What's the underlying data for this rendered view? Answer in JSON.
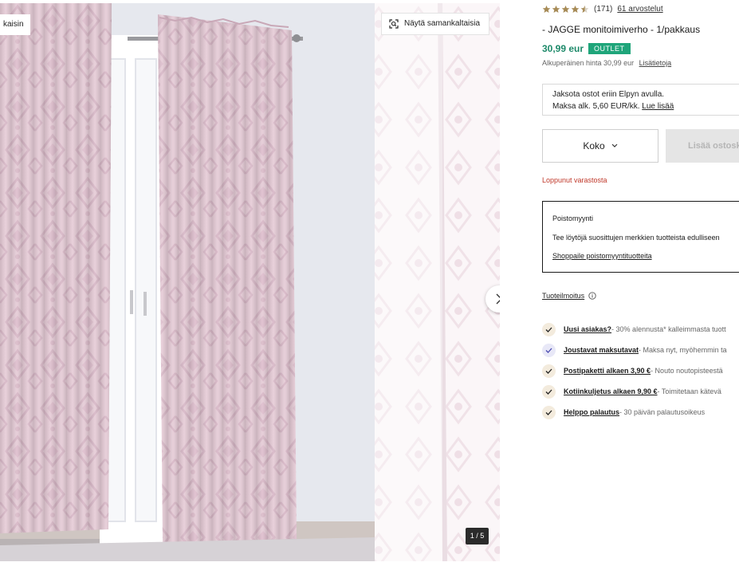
{
  "gallery": {
    "corner_tag": "kaisin",
    "similar_button": "Näytä samankaltaisia",
    "counter": "1 / 5"
  },
  "product": {
    "rating_value": 4.5,
    "rating_count": "(171)",
    "reviews_link": "61 arvostelut",
    "title": "-  JAGGE monitoimiverho - 1/pakkaus",
    "price": "30,99 eur",
    "outlet_badge": "OUTLET",
    "original_price": "Alkuperäinen hinta 30,99 eur",
    "details_link": "Lisätietoja"
  },
  "financing": {
    "line1": "Jaksota ostot eriin Elpyn avulla.",
    "line2": "Maksa alk. 5,60 EUR/kk.",
    "link": "Lue lisää"
  },
  "purchase": {
    "size_label": "Koko",
    "add_to_cart": "Lisää ostosko",
    "stock_status": "Loppunut varastosta"
  },
  "clearance": {
    "title": "Poistomyynti",
    "text": "Tee löytöjä suosittujen merkkien tuotteista edulliseen",
    "link": "Shoppaile poistomyyntituotteita"
  },
  "announcement": {
    "label": "Tuoteilmoitus"
  },
  "usps": [
    {
      "title": "Uusi asiakas?",
      "desc": " - 30% alennusta* kalleimmasta tuott"
    },
    {
      "title": "Joustavat maksutavat",
      "desc": " - Maksa nyt, myöhemmin ta"
    },
    {
      "title": "Postipaketti alkaen 3,90 €",
      "desc": " - Nouto noutopisteestä"
    },
    {
      "title": "Kotiinkuljetus alkaen 9,90 €",
      "desc": " - Toimitetaan kätevä"
    },
    {
      "title": "Helppo palautus",
      "desc": " - 30 päivän palautusoikeus"
    }
  ],
  "colors": {
    "price_green": "#1e8a6a",
    "outlet_badge": "#1fa57a",
    "stock_red": "#c0392b",
    "star_gold": "#a68a55",
    "curtain_pink": "#e6ccd7"
  }
}
